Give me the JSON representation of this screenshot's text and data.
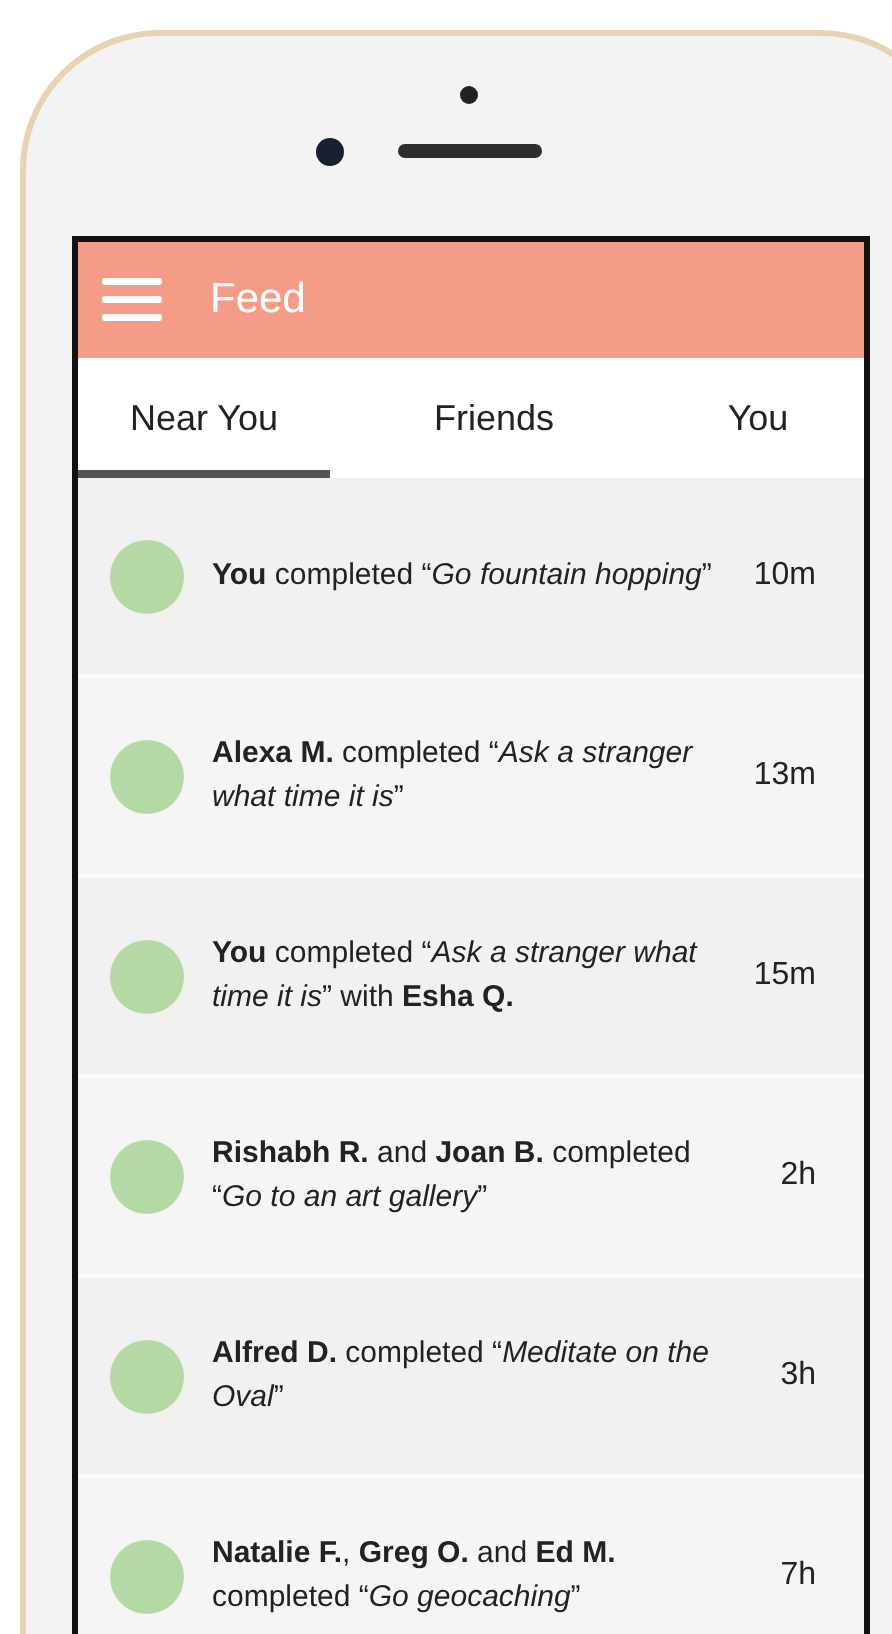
{
  "header": {
    "title": "Feed"
  },
  "tabs": [
    {
      "label": "Near You",
      "selected": true
    },
    {
      "label": "Friends",
      "selected": false
    },
    {
      "label": "You",
      "selected": false
    }
  ],
  "feed": [
    {
      "text": "**You** completed “*Go fountain hopping*”",
      "time": "10m"
    },
    {
      "text": "**Alexa M.** completed “*Ask a stranger what time it is*”",
      "time": "13m"
    },
    {
      "text": "**You** completed “*Ask a stranger what time it is*” with **Esha Q.**",
      "time": "15m"
    },
    {
      "text": "**Rishabh R.** and **Joan B.** completed “*Go to an art gallery*”",
      "time": "2h"
    },
    {
      "text": "**Alfred D.** completed “*Meditate on the Oval*”",
      "time": "3h"
    },
    {
      "text": "**Natalie F.**, **Greg O.** and **Ed M.** completed “*Go geocaching*”",
      "time": "7h"
    }
  ]
}
